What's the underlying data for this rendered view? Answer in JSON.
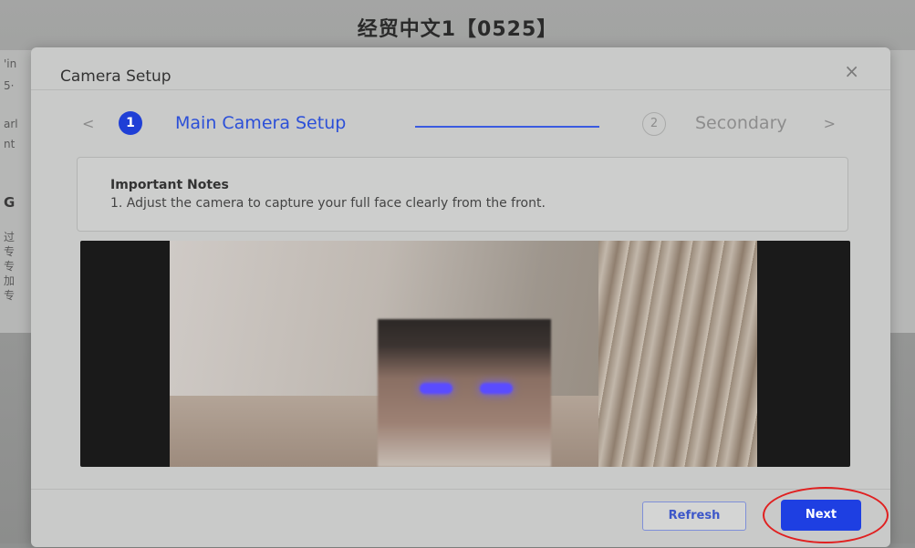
{
  "page": {
    "title": "经贸中文1【0525】",
    "background_fragments": [
      "'in",
      "5·",
      "arl",
      "nt",
      "G",
      "过",
      "专",
      "专",
      "加",
      "专"
    ]
  },
  "modal": {
    "title": "Camera Setup",
    "close_icon": "×",
    "stepper": {
      "prev_arrow": "<",
      "next_arrow": ">",
      "step1_number": "1",
      "step1_label": "Main Camera Setup",
      "step2_number": "2",
      "step2_label": "Secondary"
    },
    "notes": {
      "title": "Important Notes",
      "text": "1. Adjust the camera to capture your full face clearly from the front."
    },
    "buttons": {
      "refresh": "Refresh",
      "next": "Next"
    }
  },
  "colors": {
    "accent": "#1e3fe2",
    "highlight": "#e02020"
  }
}
